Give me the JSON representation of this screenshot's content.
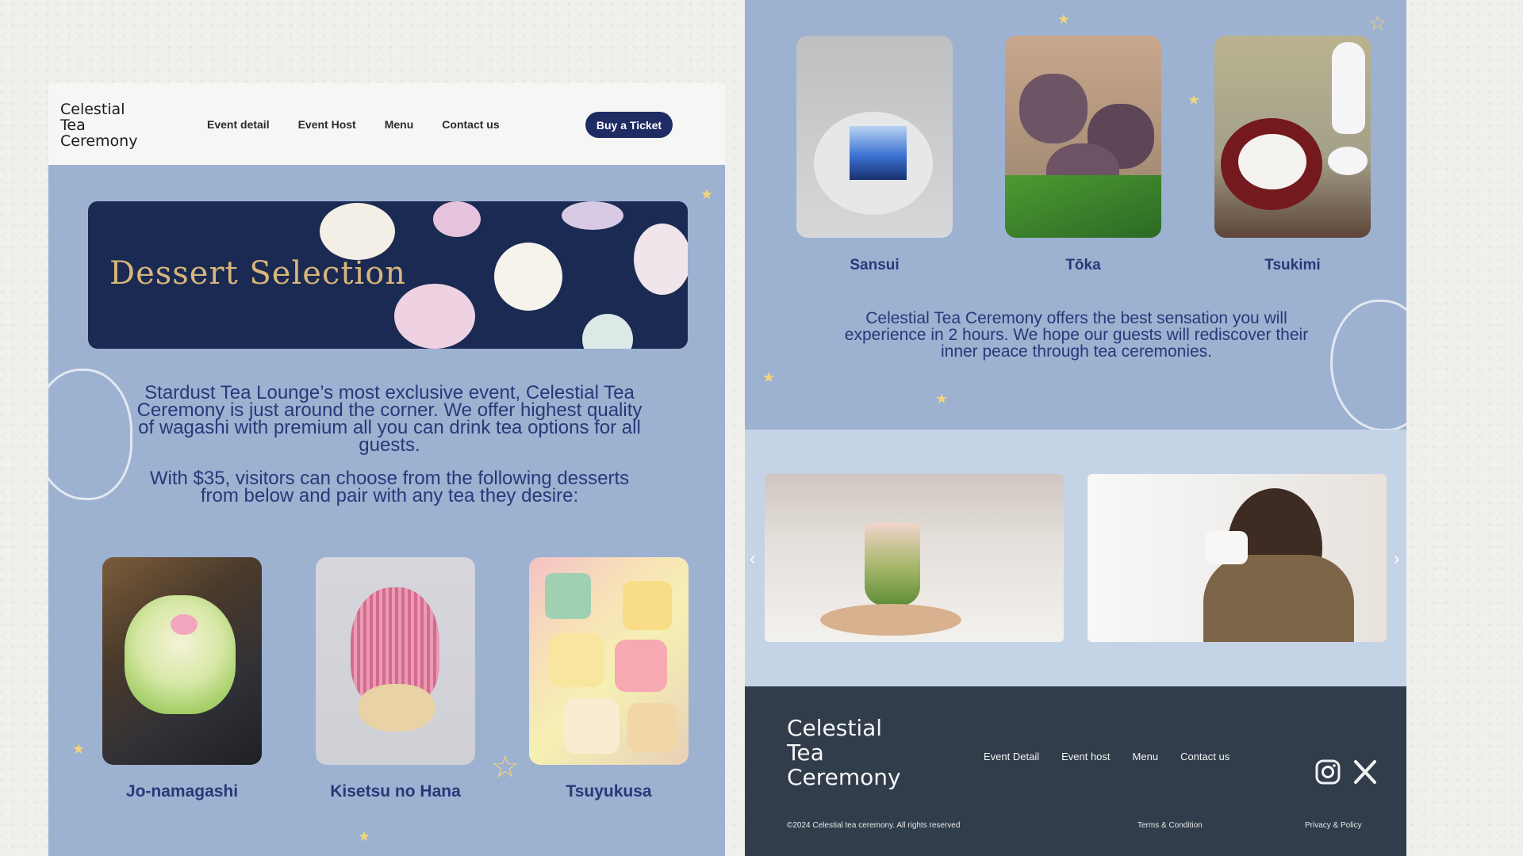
{
  "header": {
    "logo_text": "Celestial\nTea\nCeremony",
    "nav": [
      "Event detail",
      "Event Host",
      "Menu",
      "Contact us"
    ],
    "cta": "Buy a Ticket"
  },
  "hero": {
    "title": "Dessert Selection"
  },
  "intro": {
    "p1": "Stardust Tea Lounge’s most exclusive event, Celestial Tea Ceremony is just around the corner. We offer highest quality of wagashi with premium all you can drink tea options for all guests.",
    "p2": "With $35, visitors can choose from the following desserts from below and pair with any tea they desire:"
  },
  "desserts_left": [
    "Jo-namagashi",
    "Kisetsu no Hana",
    "Tsuyukusa"
  ],
  "desserts_right": [
    "Sansui",
    "Tōka",
    "Tsukimi"
  ],
  "right_text": "Celestial Tea Ceremony offers the best sensation you will experience in 2 hours. We hope our guests will rediscover their inner peace through tea ceremonies.",
  "footer": {
    "logo_text": "Celestial\nTea\nCeremony",
    "nav": [
      "Event Detail",
      "Event host",
      "Menu",
      "Contact us"
    ],
    "copyright": "©2024 Celestial tea ceremony. All rights reserved",
    "terms": "Terms & Condition",
    "privacy": "Privacy & Policy"
  },
  "colors": {
    "panel": "#9db1d1",
    "navy": "#1f2b63",
    "footer": "#313d4b",
    "gold": "#d7b57b"
  }
}
